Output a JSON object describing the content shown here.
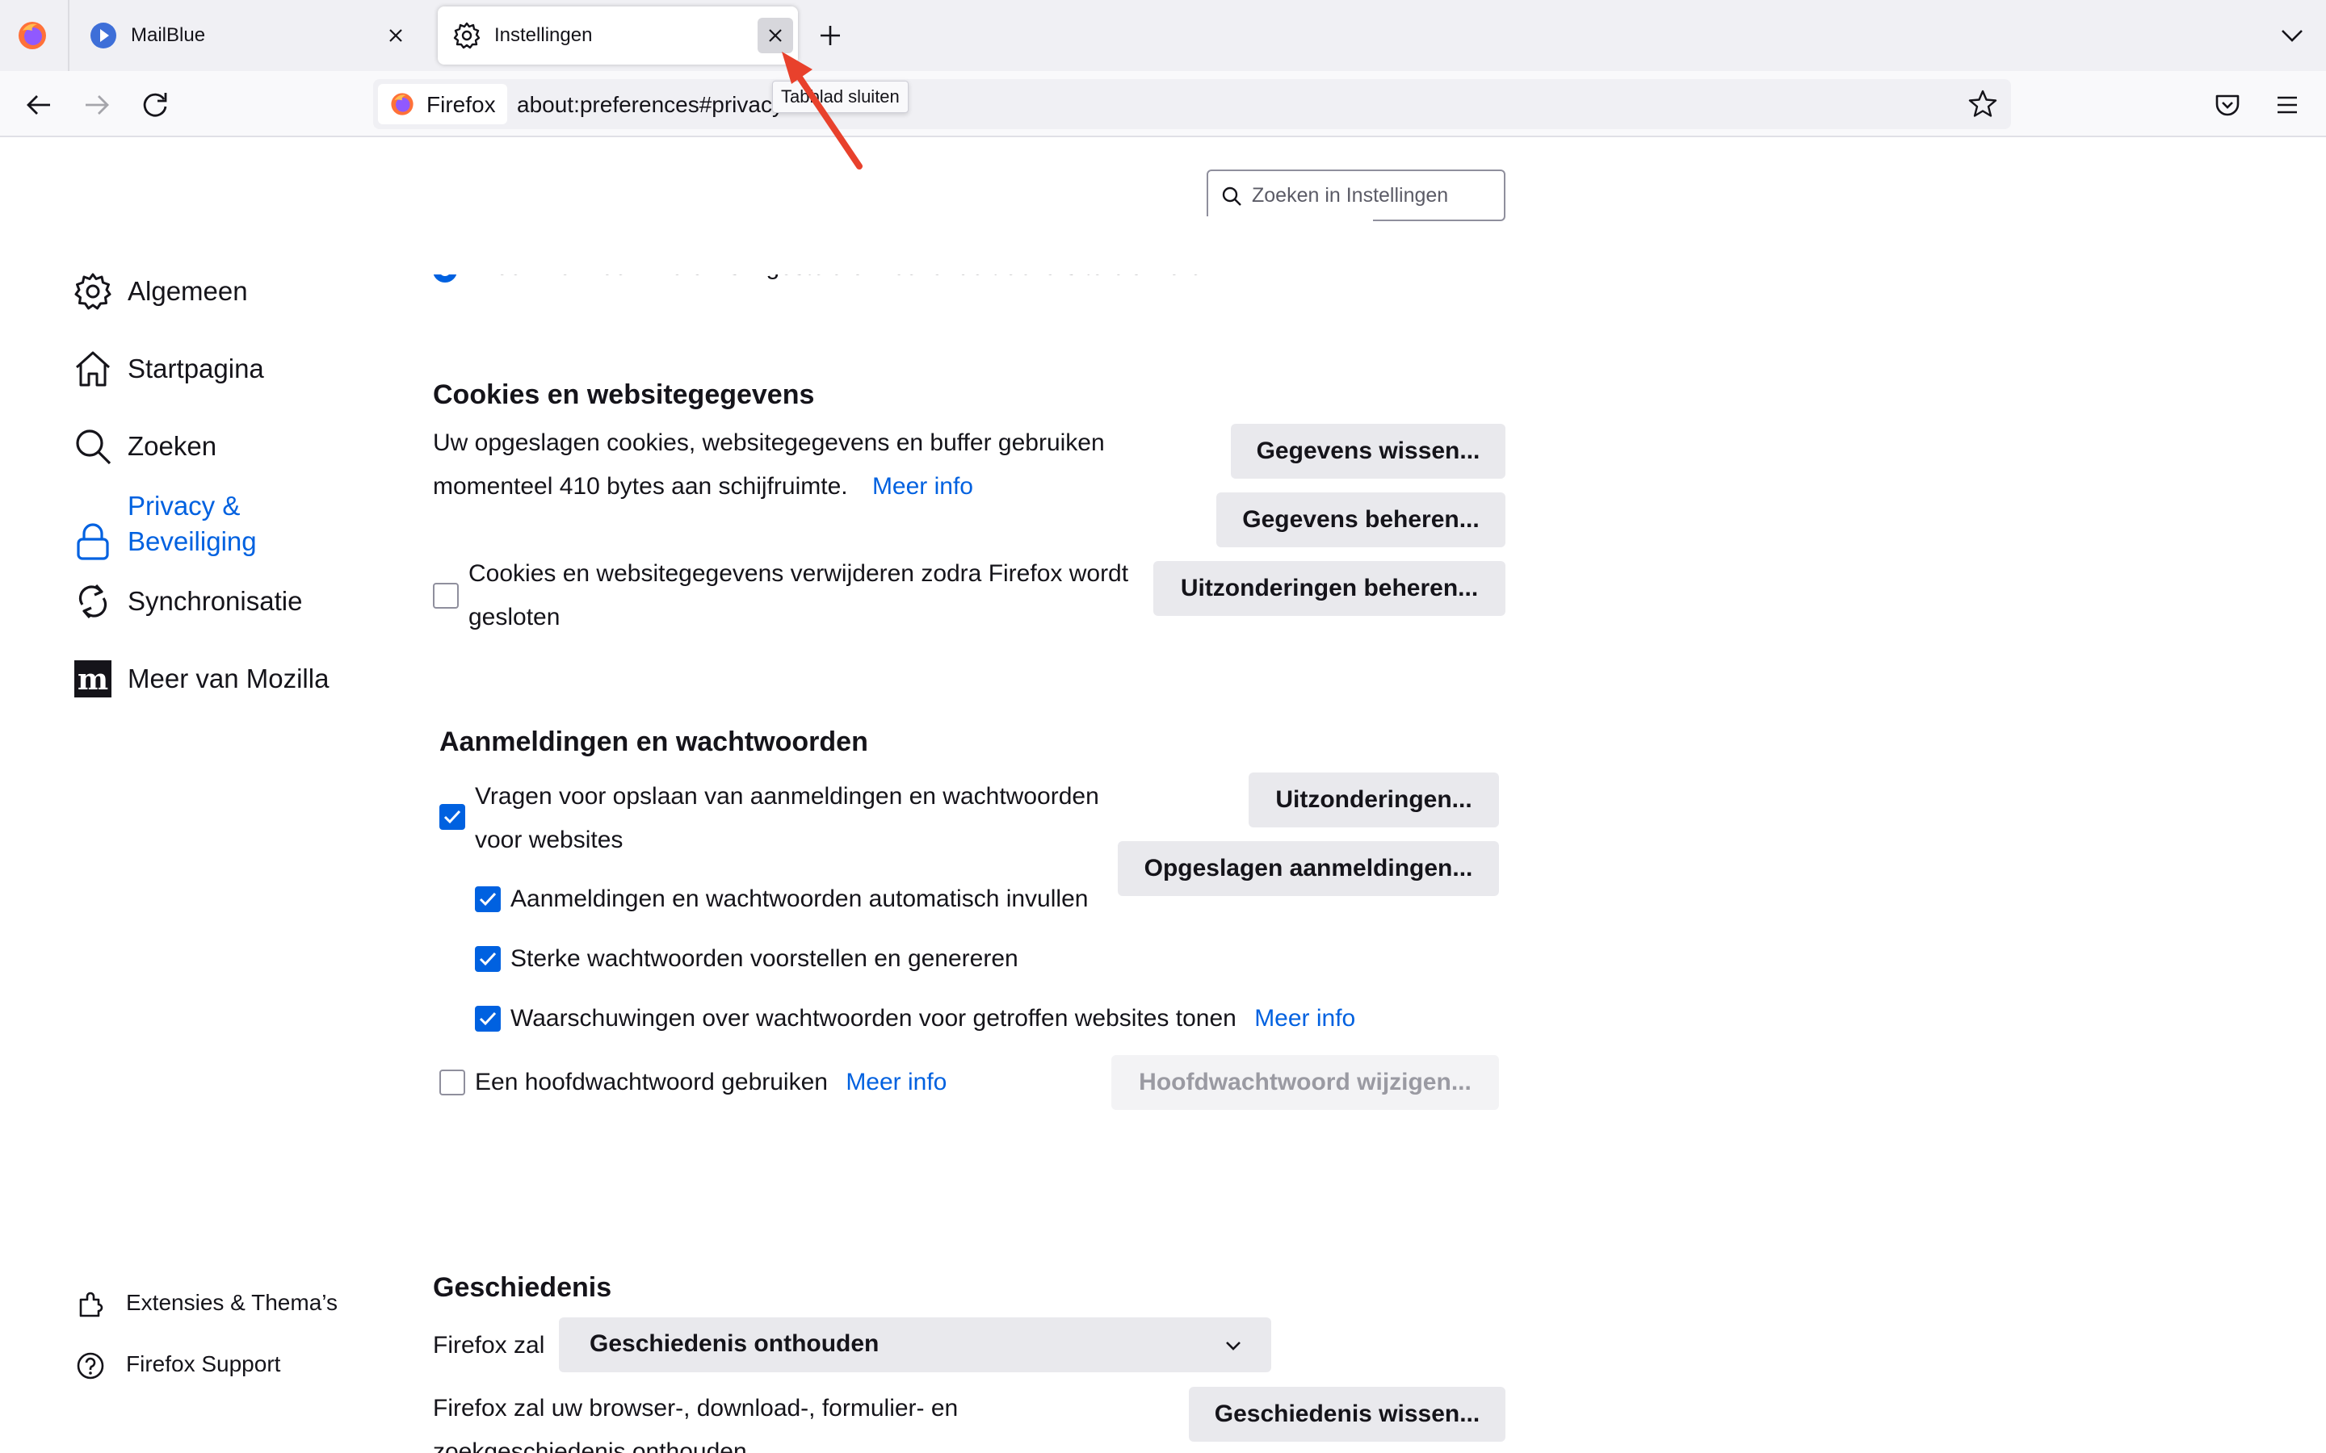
{
  "tabs": [
    {
      "label": "MailBlue",
      "icon": "mailblue-icon"
    },
    {
      "label": "Instellingen",
      "icon": "gear-icon",
      "active": true
    }
  ],
  "tooltip": "Tabblad sluiten",
  "urlbar": {
    "identity_label": "Firefox",
    "url": "about:preferences#privacy"
  },
  "search": {
    "placeholder": "Zoeken in Instellingen"
  },
  "sidebar": {
    "items": [
      {
        "label": "Algemeen",
        "icon": "gear-icon"
      },
      {
        "label": "Startpagina",
        "icon": "home-icon"
      },
      {
        "label": "Zoeken",
        "icon": "search-icon"
      },
      {
        "label_line1": "Privacy &",
        "label_line2": "Beveiliging",
        "icon": "lock-icon",
        "active": true
      },
      {
        "label": "Synchronisatie",
        "icon": "sync-icon"
      },
      {
        "label": "Meer van Mozilla",
        "icon": "mozilla-icon"
      }
    ],
    "footer": [
      {
        "label": "Extensies & Thema’s",
        "icon": "puzzle-icon"
      },
      {
        "label": "Firefox Support",
        "icon": "help-icon"
      }
    ]
  },
  "tracking_option": "Alleen wanneer Firefox is ingesteld om bekende trackers te blokkeren",
  "cookies": {
    "title": "Cookies en websitegegevens",
    "desc_line1": "Uw opgeslagen cookies, websitegegevens en buffer gebruiken",
    "desc_line2": "momenteel 410 bytes aan schijfruimte.",
    "more_info": "Meer info",
    "clear_button": "Gegevens wissen...",
    "manage_button": "Gegevens beheren...",
    "delete_on_close_line1": "Cookies en websitegegevens verwijderen zodra Firefox wordt",
    "delete_on_close_line2": "gesloten",
    "delete_on_close_checked": false,
    "exceptions_button": "Uitzonderingen beheren..."
  },
  "logins": {
    "title": "Aanmeldingen en wachtwoorden",
    "ask_save_line1": "Vragen voor opslaan van aanmeldingen en wachtwoorden",
    "ask_save_line2": "voor websites",
    "ask_save_checked": true,
    "exceptions_button": "Uitzonderingen...",
    "saved_logins_button": "Opgeslagen aanmeldingen...",
    "autofill": "Aanmeldingen en wachtwoorden automatisch invullen",
    "autofill_checked": true,
    "suggest_strong": "Sterke wachtwoorden voorstellen en genereren",
    "suggest_strong_checked": true,
    "breach_alerts": "Waarschuwingen over wachtwoorden voor getroffen websites tonen",
    "breach_alerts_checked": true,
    "breach_more_info": "Meer info",
    "primary_password": "Een hoofdwachtwoord gebruiken",
    "primary_password_checked": false,
    "primary_more_info": "Meer info",
    "change_primary_button": "Hoofdwachtwoord wijzigen..."
  },
  "history": {
    "title": "Geschiedenis",
    "firefox_will": "Firefox zal",
    "mode_selected": "Geschiedenis onthouden",
    "desc_line1": "Firefox zal uw browser-, download-, formulier- en",
    "desc_line2": "zoekgeschiedenis onthouden.",
    "clear_button": "Geschiedenis wissen..."
  },
  "colors": {
    "accent": "#0061e0",
    "annotation_arrow": "#e8412c"
  }
}
